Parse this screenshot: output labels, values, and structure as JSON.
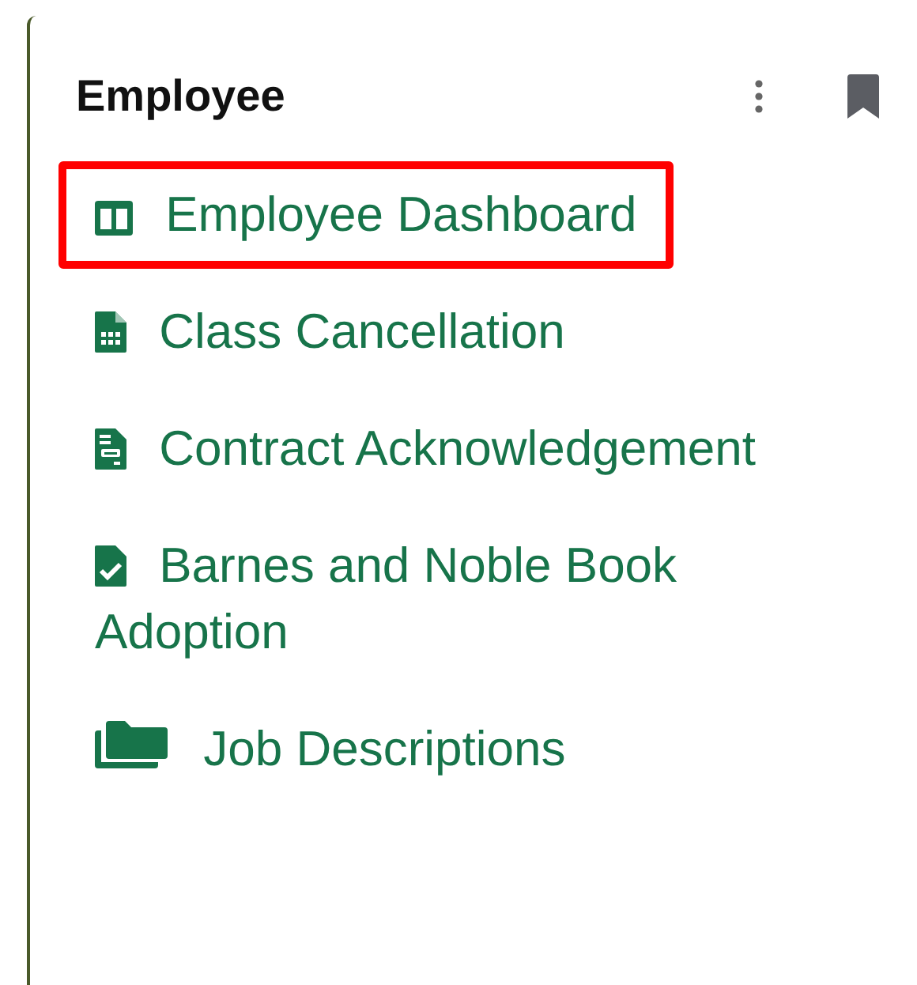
{
  "panel": {
    "title": "Employee"
  },
  "items": [
    {
      "label": "Employee Dashboard",
      "kind": "columns",
      "highlighted": true
    },
    {
      "label": "Class Cancellation",
      "kind": "sheet",
      "highlighted": false
    },
    {
      "label": "Contract Acknowledgement",
      "kind": "form",
      "highlighted": false
    },
    {
      "label": "Barnes and Noble Book Adoption",
      "kind": "check",
      "highlighted": false
    },
    {
      "label": "Job Descriptions",
      "kind": "folders",
      "highlighted": false
    }
  ]
}
